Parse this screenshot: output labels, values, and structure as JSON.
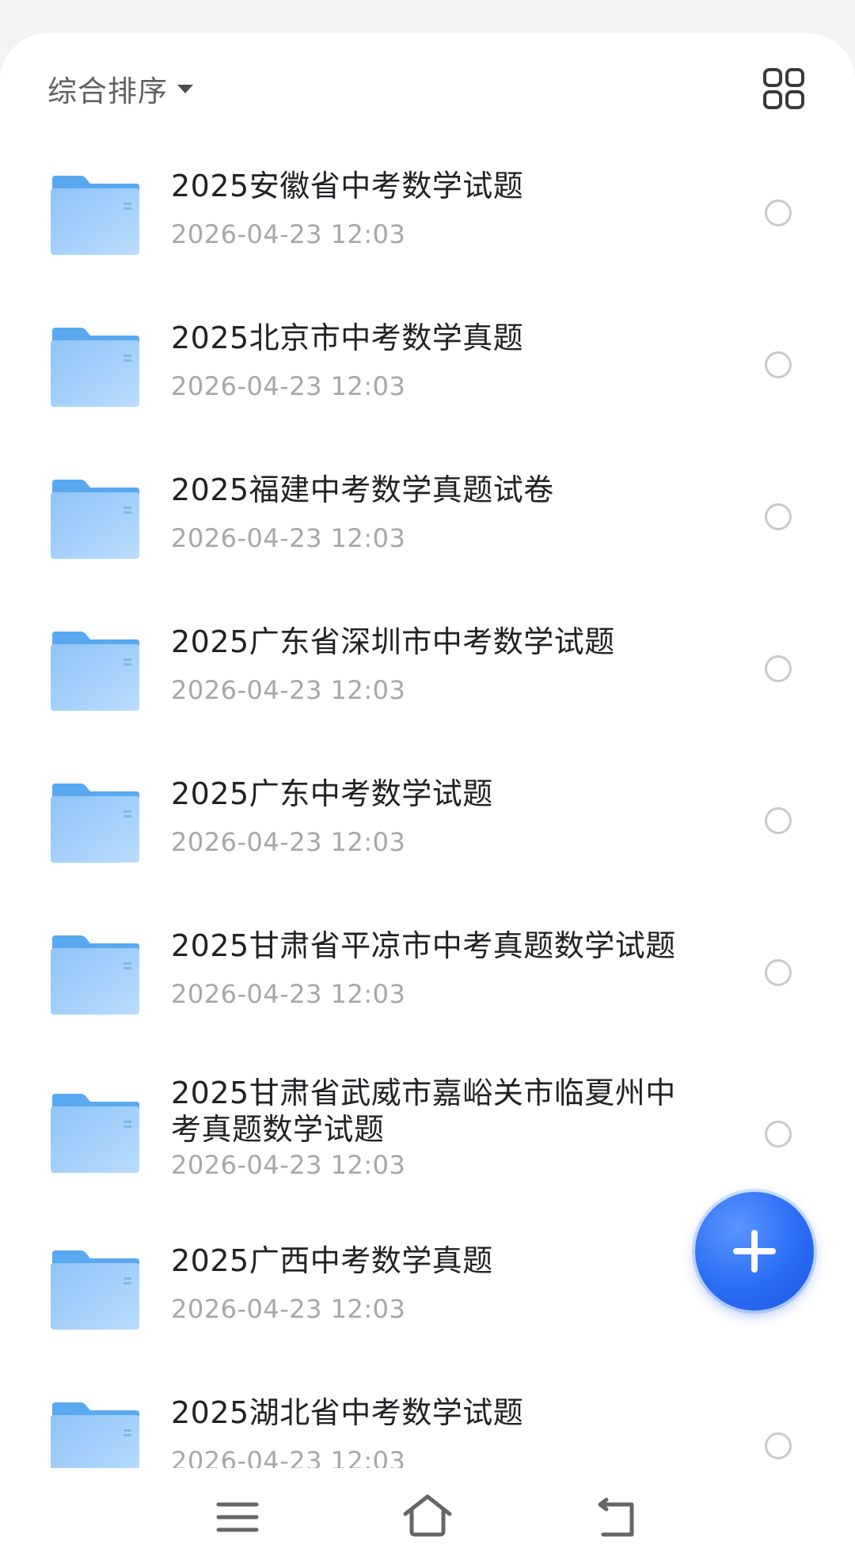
{
  "toolbar": {
    "sort_label": "综合排序",
    "sort_icon": "caret-down-icon",
    "view_toggle_icon": "grid-view-icon"
  },
  "files": [
    {
      "name": "2025安徽省中考数学试题",
      "date": "2026-04-23 12:03"
    },
    {
      "name": "2025北京市中考数学真题",
      "date": "2026-04-23 12:03"
    },
    {
      "name": "2025福建中考数学真题试卷",
      "date": "2026-04-23 12:03"
    },
    {
      "name": "2025广东省深圳市中考数学试题",
      "date": "2026-04-23 12:03"
    },
    {
      "name": "2025广东中考数学试题",
      "date": "2026-04-23 12:03"
    },
    {
      "name": "2025甘肃省平凉市中考真题数学试题",
      "date": "2026-04-23 12:03"
    },
    {
      "name": "2025甘肃省武威市嘉峪关市临夏州中考真题数学试题",
      "date": "2026-04-23 12:03"
    },
    {
      "name": "2025广西中考数学真题",
      "date": "2026-04-23 12:03"
    },
    {
      "name": "2025湖北省中考数学试题",
      "date": "2026-04-23 12:03"
    }
  ],
  "fab": {
    "icon": "plus-icon"
  },
  "navbar": {
    "icons": [
      "menu-icon",
      "home-icon",
      "back-icon"
    ]
  },
  "colors": {
    "folder_tab": "#5aa8ef",
    "folder_body": "#a9d3fb",
    "fab": "#2a6df4",
    "title_text": "#222226",
    "date_text": "#a7a7ab"
  }
}
